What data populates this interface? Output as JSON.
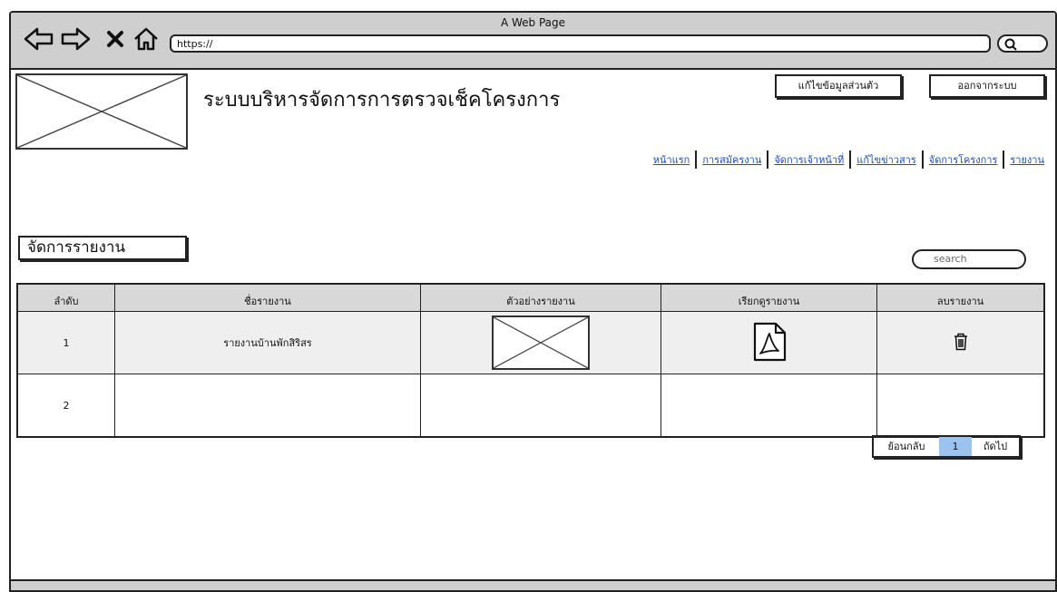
{
  "browser": {
    "window_title": "A Web Page",
    "url": "https://"
  },
  "header": {
    "app_title": "ระบบบริหารจัดการการตรวจเช็คโครงการ",
    "edit_profile_label": "แก้ไขข้อมูลส่วนตัว",
    "logout_label": "ออกจากระบบ"
  },
  "nav": {
    "items": [
      "หน้าแรก",
      "การสมัครงาน",
      "จัดการเจ้าหน้าที่",
      "แก้ไขข่าวสาร",
      "จัดการโครงการ",
      "รายงาน"
    ]
  },
  "section": {
    "title": "จัดการรายงาน"
  },
  "search": {
    "placeholder": "search"
  },
  "table": {
    "headers": [
      "ลำดับ",
      "ชื่อรายงาน",
      "ตัวอย่างรายงาน",
      "เรียกดูรายงาน",
      "ลบรายงาน"
    ],
    "rows": [
      {
        "no": "1",
        "name": "รายงานบ้านพักสิริสร"
      },
      {
        "no": "2",
        "name": ""
      }
    ]
  },
  "pagination": {
    "prev_label": "ย้อนกลับ",
    "current_page": "1",
    "next_label": "ถัดไป"
  },
  "colors": {
    "browser_bar": "#cfcfcf",
    "link": "#1f4fb5",
    "page_active": "#9cc3f0",
    "header_row": "#d8d8d8"
  }
}
